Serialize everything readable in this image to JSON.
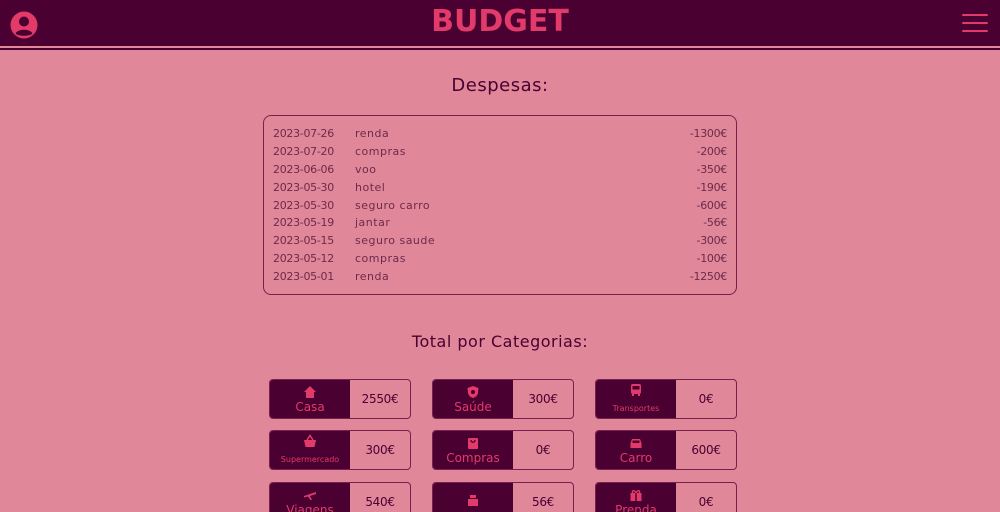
{
  "header": {
    "brand": "BUDGET",
    "colors": {
      "bar": "#4a0030",
      "accent": "#e23a6a",
      "background": "#e0879a"
    }
  },
  "expenses": {
    "title": "Despesas:",
    "rows": [
      {
        "date": "2023-07-26",
        "description": "renda",
        "amount": "-1300€"
      },
      {
        "date": "2023-07-20",
        "description": "compras",
        "amount": "-200€"
      },
      {
        "date": "2023-06-06",
        "description": "voo",
        "amount": "-350€"
      },
      {
        "date": "2023-05-30",
        "description": "hotel",
        "amount": "-190€"
      },
      {
        "date": "2023-05-30",
        "description": "seguro carro",
        "amount": "-600€"
      },
      {
        "date": "2023-05-19",
        "description": "jantar",
        "amount": "-56€"
      },
      {
        "date": "2023-05-15",
        "description": "seguro saude",
        "amount": "-300€"
      },
      {
        "date": "2023-05-12",
        "description": "compras",
        "amount": "-100€"
      },
      {
        "date": "2023-05-01",
        "description": "renda",
        "amount": "-1250€"
      }
    ]
  },
  "categories": {
    "title": "Total por Categorias:",
    "items": [
      {
        "name": "Casa",
        "total": "2550€",
        "icon": "house-icon"
      },
      {
        "name": "Saúde",
        "total": "300€",
        "icon": "health-shield-icon"
      },
      {
        "name": "Transportes",
        "total": "0€",
        "icon": "bus-icon"
      },
      {
        "name": "Supermercado",
        "total": "300€",
        "icon": "basket-icon"
      },
      {
        "name": "Compras",
        "total": "0€",
        "icon": "shopping-bag-icon"
      },
      {
        "name": "Carro",
        "total": "600€",
        "icon": "car-icon"
      },
      {
        "name": "Viagens",
        "total": "540€",
        "icon": "plane-icon"
      },
      {
        "name": "",
        "total": "56€",
        "icon": "restaurant-icon"
      },
      {
        "name": "Prenda",
        "total": "0€",
        "icon": "gift-icon"
      }
    ]
  }
}
